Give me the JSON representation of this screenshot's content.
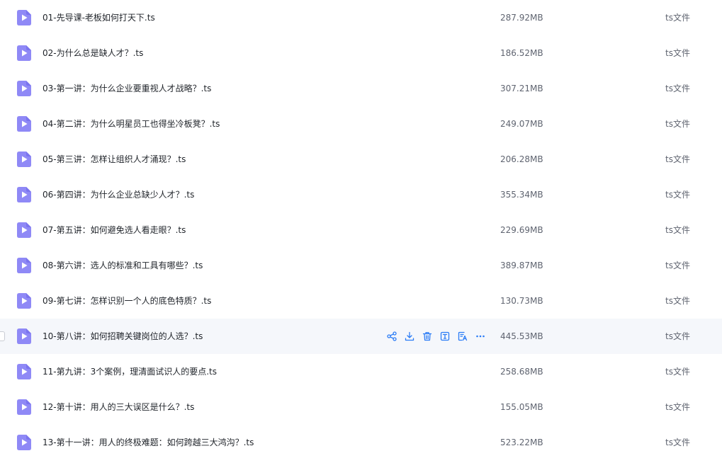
{
  "colors": {
    "icon_purple": "#8f89f6",
    "icon_purple_dark": "#7b74ee",
    "action_blue": "#2b7cf6",
    "hover_bg": "#f5f7fb",
    "text_primary": "#1f2329",
    "text_secondary": "#5f6470"
  },
  "hovered_row_index": 9,
  "row_actions": [
    {
      "name": "share-icon"
    },
    {
      "name": "download-icon"
    },
    {
      "name": "trash-icon"
    },
    {
      "name": "text-extract-icon"
    },
    {
      "name": "translate-icon"
    },
    {
      "name": "more-icon"
    }
  ],
  "files": [
    {
      "name": "01-先导课-老板如何打天下.ts",
      "size": "287.92MB",
      "type": "ts文件",
      "icon": "video-file-icon"
    },
    {
      "name": "02-为什么总是缺人才？.ts",
      "size": "186.52MB",
      "type": "ts文件",
      "icon": "video-file-icon"
    },
    {
      "name": "03-第一讲：为什么企业要重视人才战略？.ts",
      "size": "307.21MB",
      "type": "ts文件",
      "icon": "video-file-icon"
    },
    {
      "name": "04-第二讲：为什么明星员工也得坐冷板凳？.ts",
      "size": "249.07MB",
      "type": "ts文件",
      "icon": "video-file-icon"
    },
    {
      "name": "05-第三讲：怎样让组织人才涌现？.ts",
      "size": "206.28MB",
      "type": "ts文件",
      "icon": "video-file-icon"
    },
    {
      "name": "06-第四讲：为什么企业总缺少人才？.ts",
      "size": "355.34MB",
      "type": "ts文件",
      "icon": "video-file-icon"
    },
    {
      "name": "07-第五讲：如何避免选人看走眼？.ts",
      "size": "229.69MB",
      "type": "ts文件",
      "icon": "video-file-icon"
    },
    {
      "name": "08-第六讲：选人的标准和工具有哪些？.ts",
      "size": "389.87MB",
      "type": "ts文件",
      "icon": "video-file-icon"
    },
    {
      "name": "09-第七讲：怎样识别一个人的底色特质？.ts",
      "size": "130.73MB",
      "type": "ts文件",
      "icon": "video-file-icon"
    },
    {
      "name": "10-第八讲：如何招聘关键岗位的人选？.ts",
      "size": "445.53MB",
      "type": "ts文件",
      "icon": "video-file-icon"
    },
    {
      "name": "11-第九讲：3个案例，理清面试识人的要点.ts",
      "size": "258.68MB",
      "type": "ts文件",
      "icon": "video-file-icon"
    },
    {
      "name": "12-第十讲：用人的三大误区是什么？.ts",
      "size": "155.05MB",
      "type": "ts文件",
      "icon": "video-file-icon"
    },
    {
      "name": "13-第十一讲：用人的终极难题：如何跨越三大鸿沟？.ts",
      "size": "523.22MB",
      "type": "ts文件",
      "icon": "video-file-icon"
    }
  ]
}
